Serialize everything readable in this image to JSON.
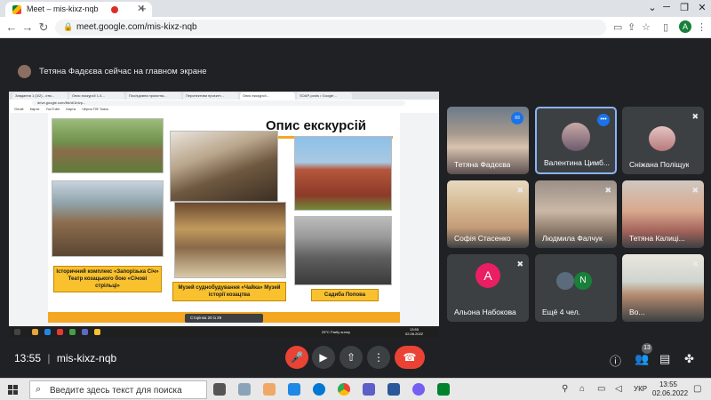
{
  "browser": {
    "tab_title": "Meet – mis-kixz-nqb",
    "url": "meet.google.com/mis-kixz-nqb",
    "profile_initial": "A"
  },
  "meet": {
    "presenter_banner": "Тетяна Фадєєва сейчас на главном экране",
    "meeting_time": "13:55",
    "meeting_code": "mis-kixz-nqb",
    "participant_count": "13"
  },
  "shared_screen": {
    "tabs": [
      "Завдання 1 (3/2) - отм...",
      "Опис екскурсії 1-4...",
      "Послідовна проєктна...",
      "Перспективи проєктн...",
      "Опис екскурсії...",
      "SOAP-posts • Google..."
    ],
    "url": "drive.google.com/file/d/1bIvp...",
    "bookmarks": [
      "Gmail",
      "Карти",
      "YouTube",
      "Карта",
      "Чёрна ПФ Ткачк"
    ],
    "slide_title": "Опис екскурсій",
    "captions": {
      "zaporizka": "Історичний комплекс «Запорізька Січ» Театр козацького бою «Січові стрільці»",
      "museum": "Музей суднобудування «Чайка» Музей історії козацтва",
      "sadyba": "Садиба Попова"
    },
    "pager": "Сторінка 20 із 29",
    "weather": "25°C Partly sunny",
    "clock": "13:55",
    "date": "02.06.2022"
  },
  "participants": [
    {
      "name": "Тетяна Фадєєва",
      "mic": "active"
    },
    {
      "name": "Валентина Цимб...",
      "mic": "more"
    },
    {
      "name": "Сніжана Поліщук",
      "mic": "muted"
    },
    {
      "name": "Софія Стасенко",
      "mic": "muted"
    },
    {
      "name": "Людмила Фалчук",
      "mic": "muted"
    },
    {
      "name": "Тетяна Калиці...",
      "mic": "muted"
    },
    {
      "name": "Альона Набокова",
      "mic": "muted",
      "initial": "А"
    },
    {
      "name": "Ещё 4 чел.",
      "mic": "none"
    },
    {
      "name": "Во...",
      "mic": "muted"
    }
  ],
  "controls": [
    "mic-off",
    "camera",
    "present",
    "more",
    "hang-up"
  ],
  "taskbar": {
    "search_placeholder": "Введите здесь текст для поиска",
    "language": "УКР",
    "time": "13:55",
    "date": "02.06.2022"
  },
  "colors": {
    "meet_bg": "#202124",
    "tile_bg": "#3c4043",
    "hangup": "#ea4335",
    "accent": "#1a73e8",
    "caption": "#f9c12e"
  }
}
